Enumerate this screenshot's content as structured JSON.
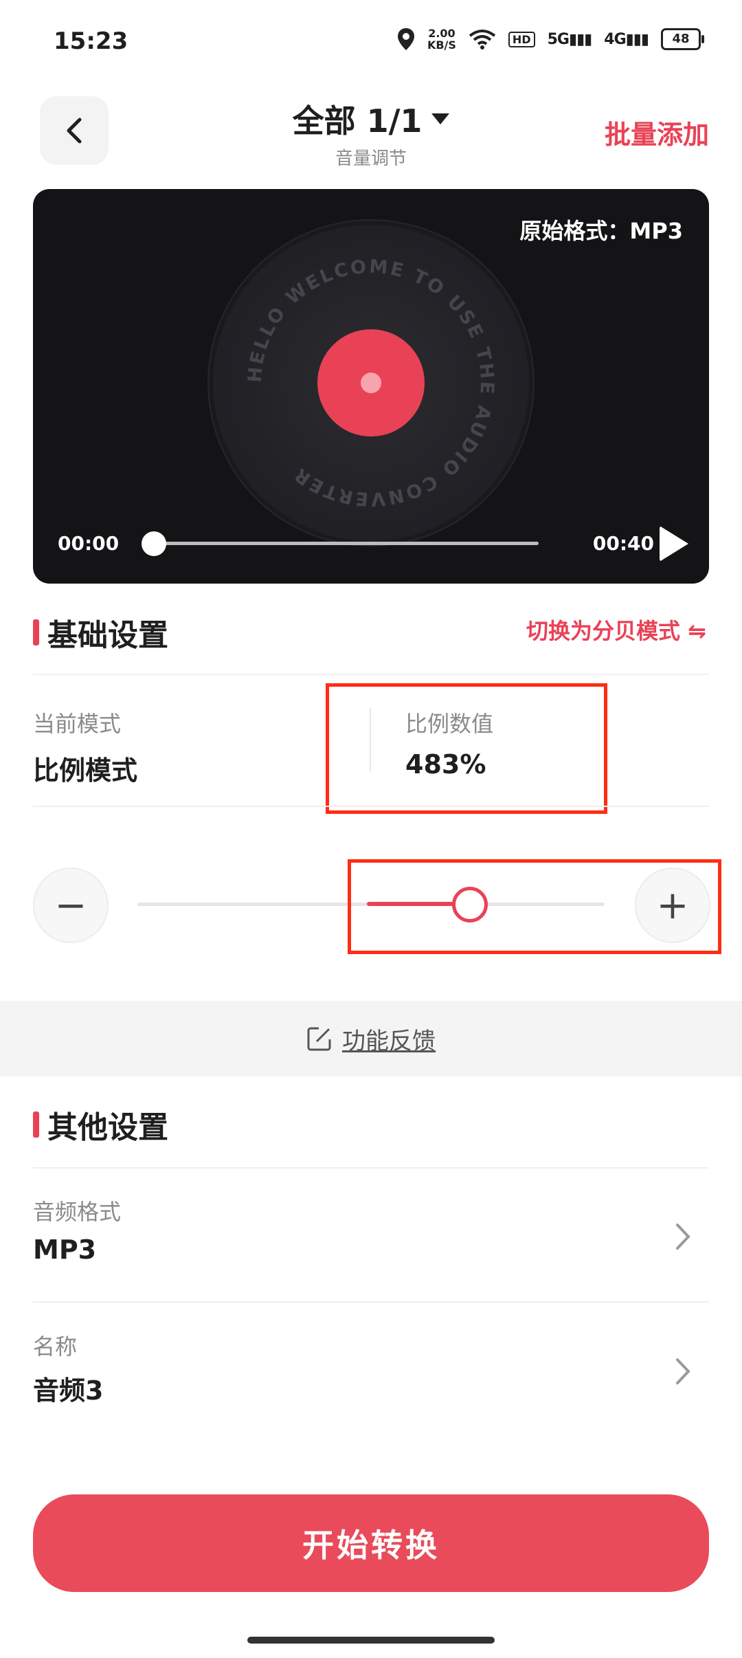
{
  "status_bar": {
    "time": "15:23",
    "net_speed": "2.00",
    "net_unit": "KB/S",
    "hd": "HD",
    "signal1": "5G",
    "signal2": "4G",
    "battery": "48"
  },
  "header": {
    "title": "全部 1/1",
    "subtitle": "音量调节",
    "batch_add": "批量添加"
  },
  "player": {
    "format_label": "原始格式：MP3",
    "disc_text": "HELLO WELCOME TO USE THE AUDIO CONVERTER",
    "current_time": "00:00",
    "total_time": "00:40",
    "progress": 0
  },
  "basic": {
    "title": "基础设置",
    "switch_mode": "切换为分贝模式 ⇋",
    "mode_label": "当前模式",
    "mode_value": "比例模式",
    "ratio_label": "比例数值",
    "ratio_value": "483%",
    "minus": "−",
    "plus": "+",
    "slider_level": 0.72
  },
  "feedback": {
    "label": "功能反馈"
  },
  "other": {
    "title": "其他设置",
    "rows": [
      {
        "label": "音频格式",
        "value": "MP3"
      },
      {
        "label": "名称",
        "value": "音频3"
      }
    ]
  },
  "start_button": "开始转换",
  "colors": {
    "accent": "#e94256",
    "highlight_box": "#ff2c14"
  }
}
